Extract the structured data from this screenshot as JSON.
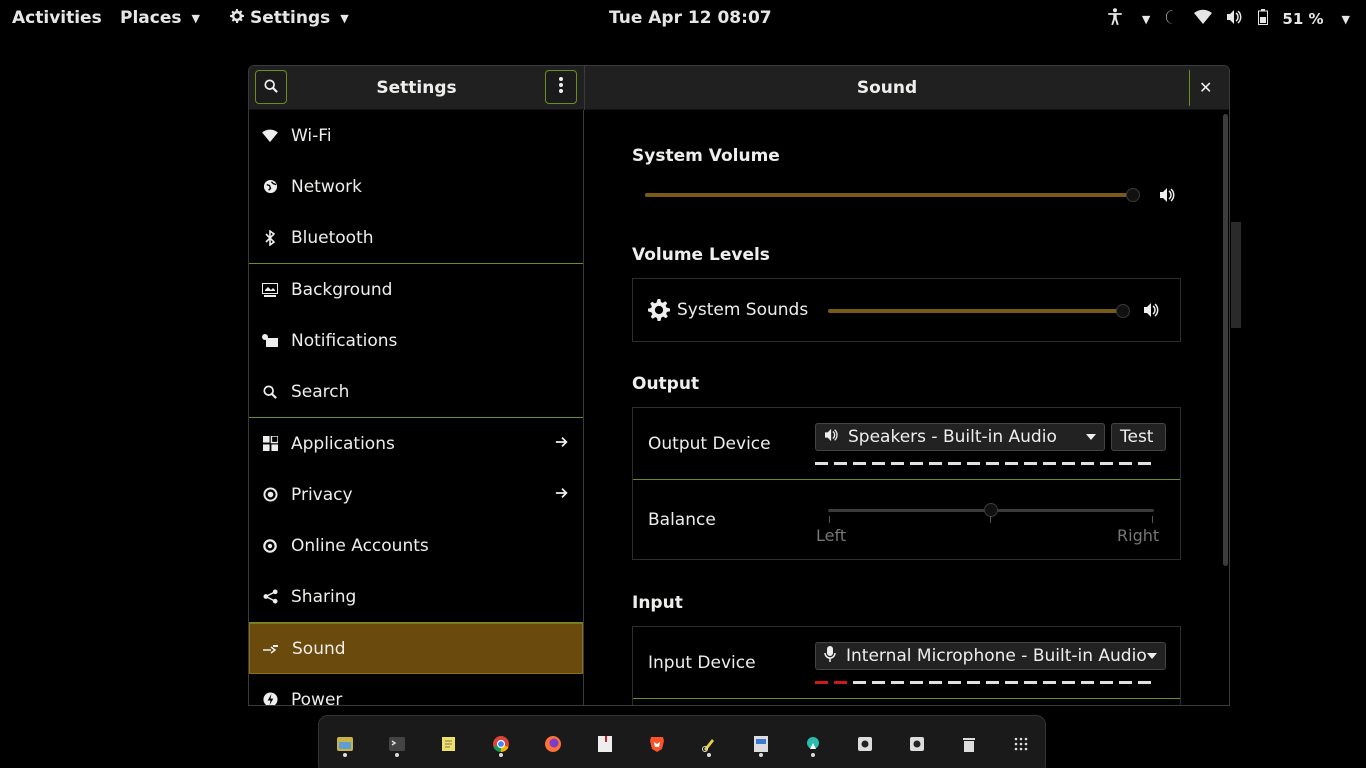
{
  "topbar": {
    "activities": "Activities",
    "places": "Places",
    "app_menu": "Settings",
    "clock": "Tue Apr 12  08:07",
    "battery": "51 %"
  },
  "window": {
    "left_title": "Settings",
    "right_title": "Sound"
  },
  "sidebar": {
    "items": [
      {
        "label": "Wi-Fi",
        "icon": "wifi-icon"
      },
      {
        "label": "Network",
        "icon": "network-icon"
      },
      {
        "label": "Bluetooth",
        "icon": "bluetooth-icon"
      },
      {
        "label": "Background",
        "icon": "background-icon"
      },
      {
        "label": "Notifications",
        "icon": "notifications-icon"
      },
      {
        "label": "Search",
        "icon": "search-icon"
      },
      {
        "label": "Applications",
        "icon": "applications-icon"
      },
      {
        "label": "Privacy",
        "icon": "privacy-icon"
      },
      {
        "label": "Online Accounts",
        "icon": "online-accounts-icon"
      },
      {
        "label": "Sharing",
        "icon": "sharing-icon"
      },
      {
        "label": "Sound",
        "icon": "sound-icon",
        "selected": true
      },
      {
        "label": "Power",
        "icon": "power-icon"
      }
    ]
  },
  "sound": {
    "system_volume_title": "System Volume",
    "system_volume_level": 1.0,
    "volume_levels_title": "Volume Levels",
    "system_sounds_label": "System Sounds",
    "system_sounds_level": 1.0,
    "output_title": "Output",
    "output_device_label": "Output Device",
    "output_device_value": "Speakers - Built-in Audio",
    "test_button": "Test",
    "balance_label": "Balance",
    "balance_left": "Left",
    "balance_right": "Right",
    "balance_level": 0.5,
    "input_title": "Input",
    "input_device_label": "Input Device",
    "input_device_value": "Internal Microphone - Built-in Audio"
  },
  "colors": {
    "accent": "#6b4a0e",
    "slider_fill": "#7a5a17",
    "border_green": "#6b8e23"
  }
}
